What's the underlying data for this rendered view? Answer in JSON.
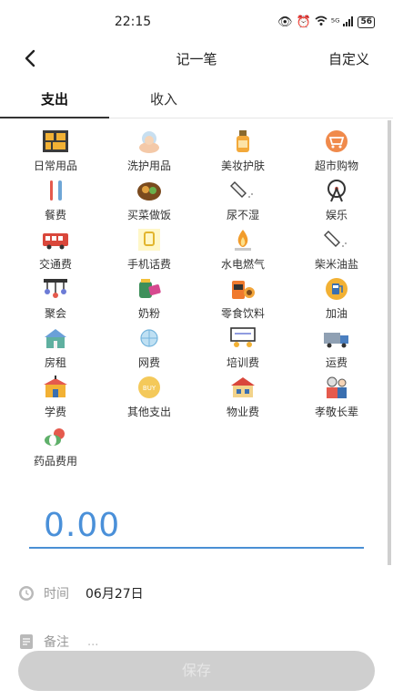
{
  "status_bar": {
    "time": "22:15",
    "signal": "⁵ᴳ",
    "battery": "56"
  },
  "nav": {
    "title": "记一笔",
    "right_action": "自定义"
  },
  "tabs": [
    {
      "label": "支出",
      "active": true
    },
    {
      "label": "收入",
      "active": false
    }
  ],
  "categories": [
    {
      "label": "日常用品",
      "icon": "daily-goods-icon"
    },
    {
      "label": "洗护用品",
      "icon": "toiletries-icon"
    },
    {
      "label": "美妆护肤",
      "icon": "cosmetics-icon"
    },
    {
      "label": "超市购物",
      "icon": "supermarket-icon"
    },
    {
      "label": "餐费",
      "icon": "dining-icon"
    },
    {
      "label": "买菜做饭",
      "icon": "cooking-icon"
    },
    {
      "label": "尿不湿",
      "icon": "diaper-icon"
    },
    {
      "label": "娱乐",
      "icon": "ferris-wheel-icon"
    },
    {
      "label": "交通费",
      "icon": "bus-icon"
    },
    {
      "label": "手机话费",
      "icon": "phone-bill-icon"
    },
    {
      "label": "水电燃气",
      "icon": "utilities-icon"
    },
    {
      "label": "柴米油盐",
      "icon": "groceries-icon"
    },
    {
      "label": "聚会",
      "icon": "party-icon"
    },
    {
      "label": "奶粉",
      "icon": "milk-powder-icon"
    },
    {
      "label": "零食饮料",
      "icon": "snacks-icon"
    },
    {
      "label": "加油",
      "icon": "fuel-icon"
    },
    {
      "label": "房租",
      "icon": "house-rent-icon"
    },
    {
      "label": "网费",
      "icon": "internet-icon"
    },
    {
      "label": "培训费",
      "icon": "training-icon"
    },
    {
      "label": "运费",
      "icon": "delivery-truck-icon"
    },
    {
      "label": "学费",
      "icon": "school-icon"
    },
    {
      "label": "其他支出",
      "icon": "other-expense-icon"
    },
    {
      "label": "物业费",
      "icon": "property-icon"
    },
    {
      "label": "孝敬长辈",
      "icon": "elders-icon"
    },
    {
      "label": "药品费用",
      "icon": "medicine-icon"
    }
  ],
  "amount": "0.00",
  "time_row": {
    "label": "时间",
    "value": "06月27日"
  },
  "note_row": {
    "label": "备注",
    "placeholder": "..."
  },
  "save_label": "保存",
  "colors": {
    "accent": "#4a90d9",
    "save_disabled": "#cfcfcf"
  }
}
